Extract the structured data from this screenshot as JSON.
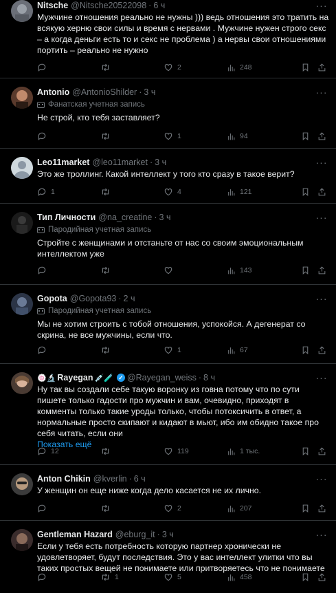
{
  "icons": {
    "reply": "reply-icon",
    "retweet": "retweet-icon",
    "like": "heart-icon",
    "views": "views-bar-chart-icon",
    "bookmark": "bookmark-icon",
    "share": "share-icon",
    "more": "more-dots-icon",
    "badge": "mask-icon"
  },
  "colors": {
    "background": "#000000",
    "muted": "#71767b",
    "accent": "#1d9bf0",
    "divider": "#2f3336",
    "text": "#e7e9ea"
  },
  "ui": {
    "more_label": "···",
    "dot": "·"
  },
  "posts": [
    {
      "name": "Nitsche",
      "handle": "@Nitsche20522098",
      "time": "6 ч",
      "badge": "",
      "text": "Мужчине отношения реально не нужны ))) ведь отношения это тратить на всякую херню свои силы и время с нервами . Мужчине нужен строго секс – а когда деньги есть то и секс не проблема ) а нервы свои отношениями портить – реально не нужно",
      "replies": "",
      "retweets": "",
      "likes": "2",
      "views": "248"
    },
    {
      "name": "Antonio",
      "handle": "@AntonioShilder",
      "time": "3 ч",
      "badge": "Фанатская учетная запись",
      "text": "Не строй, кто тебя заставляет?",
      "replies": "",
      "retweets": "",
      "likes": "1",
      "views": "94"
    },
    {
      "name": "Leo11market",
      "handle": "@leo11market",
      "time": "3 ч",
      "badge": "",
      "text": "Это же троллинг. Какой интеллект у того кто сразу в такое верит?",
      "replies": "1",
      "retweets": "",
      "likes": "4",
      "views": "121"
    },
    {
      "name": "Тип Личности",
      "handle": "@na_creatine",
      "time": "3 ч",
      "badge": "Пародийная учетная запись",
      "text": "Стройте с женщинами и отстаньте от нас со своим эмоциональным интеллектом уже",
      "replies": "",
      "retweets": "",
      "likes": "",
      "views": "143"
    },
    {
      "name": "Gopota",
      "handle": "@Gopota93",
      "time": "2 ч",
      "badge": "Пародийная учетная запись",
      "text": "Мы не хотим строить с тобой отношения, успокойся. А дегенерат со скрина, не все мужчины, если что.",
      "replies": "",
      "retweets": "",
      "likes": "1",
      "views": "67"
    },
    {
      "name": "Rayegan",
      "name_prefix": "🍥🔬",
      "name_suffix": "💉🧪",
      "handle": "@Rayegan_weiss",
      "time": "8 ч",
      "badge": "",
      "text": "Ну так вы создали себе такую воронку из говна потому что по сути пишете только гадости про мужчин и вам, очевидно, приходят в комменты только такие уроды только, чтобы потоксичить в ответ, а нормальные просто скипают и кидают в мьют, ибо им обидно такое про себя читать, если они",
      "show_more": "Показать ещё",
      "replies": "12",
      "retweets": "",
      "likes": "119",
      "views": "1 тыс."
    },
    {
      "name": "Anton Chikin",
      "handle": "@kverlin",
      "time": "6 ч",
      "badge": "",
      "text": "У женщин он еще ниже когда дело касается не их лично.",
      "replies": "",
      "retweets": "",
      "likes": "2",
      "views": "207"
    },
    {
      "name": "Gentleman Hazard",
      "handle": "@eburg_it",
      "time": "3 ч",
      "badge": "",
      "text": "Если у тебя есть потребность которую партнер хронически не удовлетворяет, будут последствия. Это у вас интеллект улитки что вы таких простых вещей не понимаете или притворяетесь что не понимаете",
      "replies": "",
      "retweets": "1",
      "likes": "5",
      "views": "458"
    }
  ]
}
